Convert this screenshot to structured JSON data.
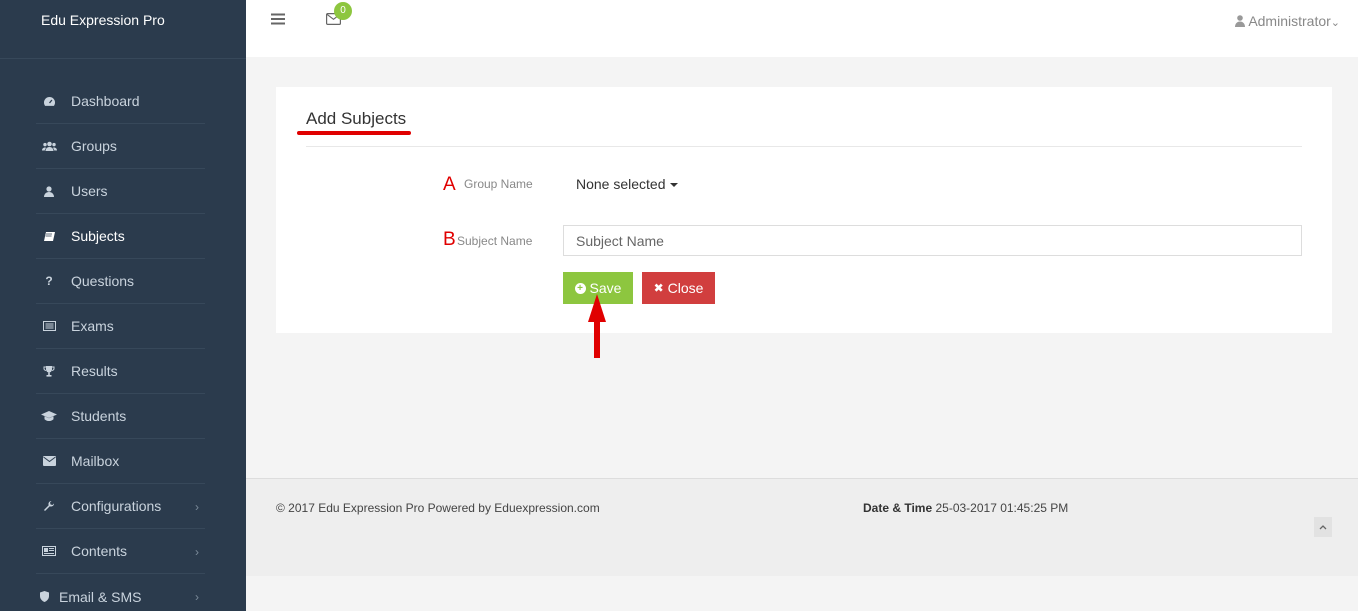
{
  "app": {
    "brand": "Edu Expression Pro"
  },
  "sidebar": {
    "items": [
      {
        "label": "Dashboard",
        "icon": "dashboard-icon"
      },
      {
        "label": "Groups",
        "icon": "groups-icon"
      },
      {
        "label": "Users",
        "icon": "user-icon"
      },
      {
        "label": "Subjects",
        "icon": "book-icon",
        "active": true
      },
      {
        "label": "Questions",
        "icon": "question-icon"
      },
      {
        "label": "Exams",
        "icon": "exam-icon"
      },
      {
        "label": "Results",
        "icon": "trophy-icon"
      },
      {
        "label": "Students",
        "icon": "graduation-cap-icon"
      },
      {
        "label": "Mailbox",
        "icon": "envelope-icon"
      },
      {
        "label": "Configurations",
        "icon": "wrench-icon",
        "has_submenu": true
      },
      {
        "label": "Contents",
        "icon": "contents-icon",
        "has_submenu": true
      },
      {
        "label": "Email & SMS",
        "icon": "shield-icon",
        "has_submenu": true
      }
    ]
  },
  "topbar": {
    "mail_count": "0",
    "user": "Administrator"
  },
  "form": {
    "title": "Add Subjects",
    "marker_a": "A",
    "marker_b": "B",
    "group_label": "Group Name",
    "group_value": "None selected",
    "subject_label": "Subject Name",
    "subject_placeholder": "Subject Name",
    "subject_value": "",
    "save_label": "Save",
    "close_label": "Close"
  },
  "footer": {
    "copyright": "© 2017 Edu Expression Pro Powered by Eduexpression.com",
    "datetime_label": "Date & Time",
    "datetime_value": "25-03-2017 01:45:25 PM"
  },
  "colors": {
    "sidebar_bg": "#2b3b4d",
    "accent_green": "#8dc63f",
    "danger_red": "#d13e3e",
    "annotation_red": "#e00000"
  }
}
